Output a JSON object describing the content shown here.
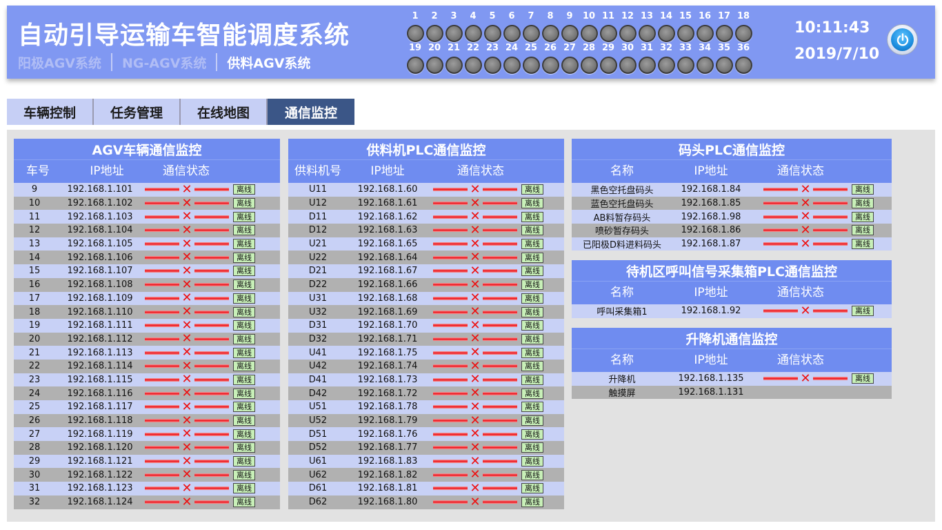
{
  "header": {
    "title": "自动引导运输车智能调度系统",
    "systems": [
      {
        "label": "阳极AGV系统",
        "active": false
      },
      {
        "label": "NG-AGV系统",
        "active": false
      },
      {
        "label": "供料AGV系统",
        "active": true
      }
    ],
    "indicators_row1": [
      "1",
      "2",
      "3",
      "4",
      "5",
      "6",
      "7",
      "8",
      "9",
      "10",
      "11",
      "12",
      "13",
      "14",
      "15",
      "16",
      "17",
      "18"
    ],
    "indicators_row2": [
      "19",
      "20",
      "21",
      "22",
      "23",
      "24",
      "25",
      "26",
      "27",
      "28",
      "29",
      "30",
      "31",
      "32",
      "33",
      "34",
      "35",
      "36"
    ],
    "time": "10:11:43",
    "date": "2019/7/10",
    "power_icon": "power-icon"
  },
  "tabs": [
    {
      "label": "车辆控制",
      "active": false
    },
    {
      "label": "任务管理",
      "active": false
    },
    {
      "label": "在线地图",
      "active": false
    },
    {
      "label": "通信监控",
      "active": true
    }
  ],
  "colors": {
    "header": "#8098f2",
    "panel": "#6f8cf0",
    "active_tab": "#3b5687",
    "offline_line": "#ee1c24",
    "offline_badge": "#c8f0b8"
  },
  "agv_panel": {
    "title": "AGV车辆通信监控",
    "headers": [
      "车号",
      "IP地址",
      "通信状态"
    ],
    "rows": [
      {
        "id": "9",
        "ip": "192.168.1.101",
        "status": "离线"
      },
      {
        "id": "10",
        "ip": "192.168.1.102",
        "status": "离线"
      },
      {
        "id": "11",
        "ip": "192.168.1.103",
        "status": "离线"
      },
      {
        "id": "12",
        "ip": "192.168.1.104",
        "status": "离线"
      },
      {
        "id": "13",
        "ip": "192.168.1.105",
        "status": "离线"
      },
      {
        "id": "14",
        "ip": "192.168.1.106",
        "status": "离线"
      },
      {
        "id": "15",
        "ip": "192.168.1.107",
        "status": "离线"
      },
      {
        "id": "16",
        "ip": "192.168.1.108",
        "status": "离线"
      },
      {
        "id": "17",
        "ip": "192.168.1.109",
        "status": "离线"
      },
      {
        "id": "18",
        "ip": "192.168.1.110",
        "status": "离线"
      },
      {
        "id": "19",
        "ip": "192.168.1.111",
        "status": "离线"
      },
      {
        "id": "20",
        "ip": "192.168.1.112",
        "status": "离线"
      },
      {
        "id": "21",
        "ip": "192.168.1.113",
        "status": "离线"
      },
      {
        "id": "22",
        "ip": "192.168.1.114",
        "status": "离线"
      },
      {
        "id": "23",
        "ip": "192.168.1.115",
        "status": "离线"
      },
      {
        "id": "24",
        "ip": "192.168.1.116",
        "status": "离线"
      },
      {
        "id": "25",
        "ip": "192.168.1.117",
        "status": "离线"
      },
      {
        "id": "26",
        "ip": "192.168.1.118",
        "status": "离线"
      },
      {
        "id": "27",
        "ip": "192.168.1.119",
        "status": "离线"
      },
      {
        "id": "28",
        "ip": "192.168.1.120",
        "status": "离线"
      },
      {
        "id": "29",
        "ip": "192.168.1.121",
        "status": "离线"
      },
      {
        "id": "30",
        "ip": "192.168.1.122",
        "status": "离线"
      },
      {
        "id": "31",
        "ip": "192.168.1.123",
        "status": "离线"
      },
      {
        "id": "32",
        "ip": "192.168.1.124",
        "status": "离线"
      }
    ]
  },
  "feeder_panel": {
    "title": "供料机PLC通信监控",
    "headers": [
      "供料机号",
      "IP地址",
      "通信状态"
    ],
    "rows": [
      {
        "id": "U11",
        "ip": "192.168.1.60",
        "status": "离线"
      },
      {
        "id": "U12",
        "ip": "192.168.1.61",
        "status": "离线"
      },
      {
        "id": "D11",
        "ip": "192.168.1.62",
        "status": "离线"
      },
      {
        "id": "D12",
        "ip": "192.168.1.63",
        "status": "离线"
      },
      {
        "id": "U21",
        "ip": "192.168.1.65",
        "status": "离线"
      },
      {
        "id": "U22",
        "ip": "192.168.1.64",
        "status": "离线"
      },
      {
        "id": "D21",
        "ip": "192.168.1.67",
        "status": "离线"
      },
      {
        "id": "D22",
        "ip": "192.168.1.66",
        "status": "离线"
      },
      {
        "id": "U31",
        "ip": "192.168.1.68",
        "status": "离线"
      },
      {
        "id": "U32",
        "ip": "192.168.1.69",
        "status": "离线"
      },
      {
        "id": "D31",
        "ip": "192.168.1.70",
        "status": "离线"
      },
      {
        "id": "D32",
        "ip": "192.168.1.71",
        "status": "离线"
      },
      {
        "id": "U41",
        "ip": "192.168.1.75",
        "status": "离线"
      },
      {
        "id": "U42",
        "ip": "192.168.1.74",
        "status": "离线"
      },
      {
        "id": "D41",
        "ip": "192.168.1.73",
        "status": "离线"
      },
      {
        "id": "D42",
        "ip": "192.168.1.72",
        "status": "离线"
      },
      {
        "id": "U51",
        "ip": "192.168.1.78",
        "status": "离线"
      },
      {
        "id": "U52",
        "ip": "192.168.1.79",
        "status": "离线"
      },
      {
        "id": "D51",
        "ip": "192.168.1.76",
        "status": "离线"
      },
      {
        "id": "D52",
        "ip": "192.168.1.77",
        "status": "离线"
      },
      {
        "id": "U61",
        "ip": "192.168.1.83",
        "status": "离线"
      },
      {
        "id": "U62",
        "ip": "192.168.1.82",
        "status": "离线"
      },
      {
        "id": "D61",
        "ip": "192.168.1.81",
        "status": "离线"
      },
      {
        "id": "D62",
        "ip": "192.168.1.80",
        "status": "离线"
      }
    ]
  },
  "dock_panel": {
    "title": "码头PLC通信监控",
    "headers": [
      "名称",
      "IP地址",
      "通信状态"
    ],
    "rows": [
      {
        "id": "黑色空托盘码头",
        "ip": "192.168.1.84",
        "status": "离线"
      },
      {
        "id": "蓝色空托盘码头",
        "ip": "192.168.1.85",
        "status": "离线"
      },
      {
        "id": "AB料暂存码头",
        "ip": "192.168.1.98",
        "status": "离线"
      },
      {
        "id": "喷砂暂存码头",
        "ip": "192.168.1.86",
        "status": "离线"
      },
      {
        "id": "已阳极D料进料码头",
        "ip": "192.168.1.87",
        "status": "离线"
      }
    ]
  },
  "call_panel": {
    "title": "待机区呼叫信号采集箱PLC通信监控",
    "headers": [
      "名称",
      "IP地址",
      "通信状态"
    ],
    "rows": [
      {
        "id": "呼叫采集箱1",
        "ip": "192.168.1.92",
        "status": "离线"
      }
    ]
  },
  "lift_panel": {
    "title": "升降机通信监控",
    "headers": [
      "名称",
      "IP地址",
      "通信状态"
    ],
    "rows": [
      {
        "id": "升降机",
        "ip": "192.168.1.135",
        "status": "离线"
      },
      {
        "id": "触摸屏",
        "ip": "192.168.1.131",
        "status": ""
      }
    ]
  }
}
